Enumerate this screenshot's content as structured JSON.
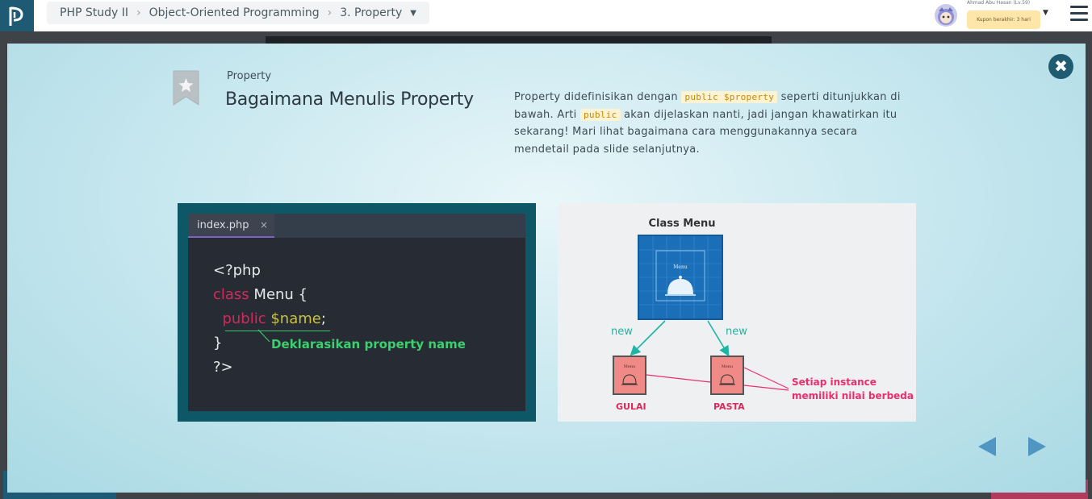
{
  "header": {
    "breadcrumb": [
      "PHP Study II",
      "Object-Oriented Programming",
      "3. Property"
    ],
    "user_name": "Ahmad Abu Hasan (Lv.59)",
    "coupon": "Kupon berakhir: 3 hari"
  },
  "slide": {
    "section": "Property",
    "title": "Bagaimana Menulis Property",
    "desc_part1": "Property didefinisikan dengan ",
    "desc_code1": "public $property",
    "desc_part2": " seperti ditunjukkan di bawah. Arti ",
    "desc_code2": "public",
    "desc_part3": " akan dijelaskan nanti, jadi jangan khawatirkan itu sekarang! Mari lihat bagaimana cara menggunakannya secara mendetail pada slide selanjutnya."
  },
  "code_panel": {
    "tab_name": "index.php",
    "tab_close": "×",
    "line1": "<?php",
    "kw_class": "class",
    "class_name": " Menu {",
    "kw_public": "public",
    "var_name": " $name",
    "semicolon": ";",
    "line4": "}",
    "line5": "?>",
    "annotation": "Deklarasikan property name"
  },
  "diagram": {
    "class_title": "Class Menu",
    "menu_label": "Menu",
    "new_label": "new",
    "instance_left": "GULAI",
    "instance_right": "PASTA",
    "note_line1": "Setiap instance",
    "note_line2": "memiliki nilai berbeda"
  },
  "colors": {
    "brand": "#1e5a73",
    "accent_nav": "#4f97c2",
    "code_keyword": "#d3295c",
    "code_variable": "#c8c23e",
    "annotation_green": "#3bd06e",
    "instance_label": "#d92a5b"
  },
  "icons": [
    "logo-icon",
    "chevron-right-icon",
    "caret-down-icon",
    "avatar-icon",
    "hamburger-menu-icon",
    "close-icon",
    "bookmark-star-icon",
    "arrow-left-icon",
    "arrow-right-icon"
  ]
}
